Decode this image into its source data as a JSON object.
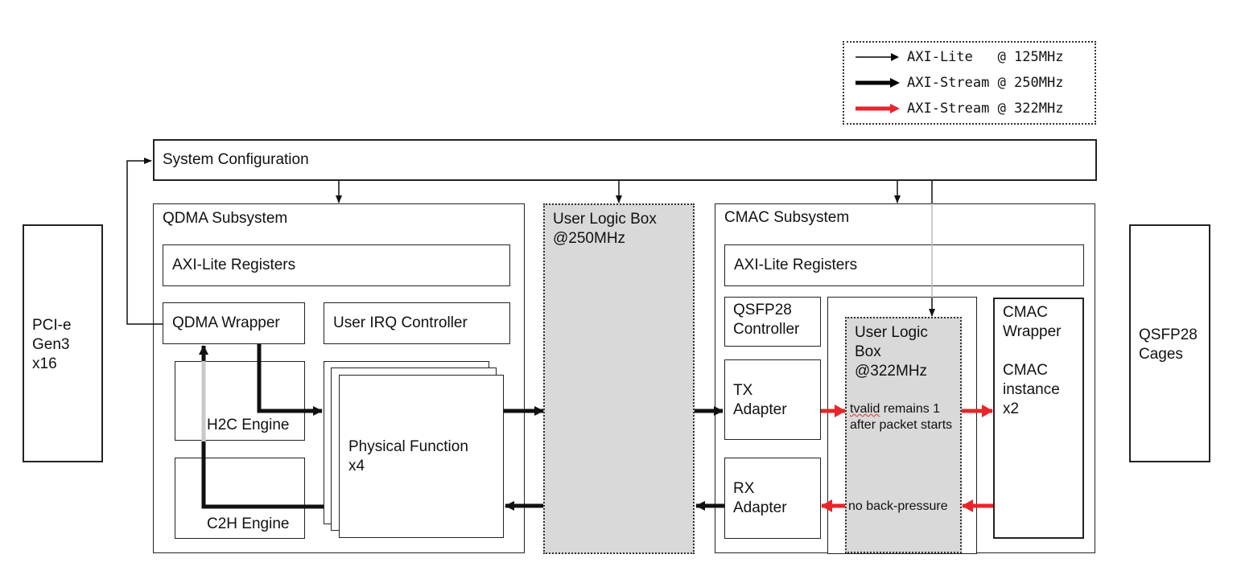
{
  "legend": {
    "items": [
      {
        "label": "AXI-Lite   @ 125MHz",
        "style": "thin",
        "color": "#000000"
      },
      {
        "label": "AXI-Stream @ 250MHz",
        "style": "thick",
        "color": "#000000"
      },
      {
        "label": "AXI-Stream @ 322MHz",
        "style": "thick",
        "color": "#e8252b"
      }
    ]
  },
  "blocks": {
    "pcie": "PCI-e\nGen3\nx16",
    "qsfp_cages": "QSFP28\nCages",
    "system_config": "System Configuration",
    "qdma": {
      "title": "QDMA Subsystem",
      "axi_lite_regs": "AXI-Lite Registers",
      "wrapper": "QDMA Wrapper",
      "irq": "User IRQ Controller",
      "h2c": "H2C Engine",
      "c2h": "C2H Engine",
      "pf": "Physical Function\nx4"
    },
    "user_logic_250": "User Logic Box\n@250MHz",
    "cmac": {
      "title": "CMAC Subsystem",
      "axi_lite_regs": "AXI-Lite Registers",
      "qsfp_ctrl": "QSFP28\nController",
      "tx": "TX\nAdapter",
      "rx": "RX\nAdapter",
      "user_logic_322": "User Logic\nBox\n@322MHz",
      "tx_note_word": "tvalid",
      "tx_note_rest": " remains 1\nafter packet starts",
      "rx_note": "no back-pressure",
      "cmac_wrapper": "CMAC\nWrapper",
      "cmac_instance": "CMAC\ninstance\nx2"
    }
  },
  "colors": {
    "stream_322": "#e8252b",
    "user_logic_fill": "#d9d9d9",
    "line": "#111111"
  }
}
